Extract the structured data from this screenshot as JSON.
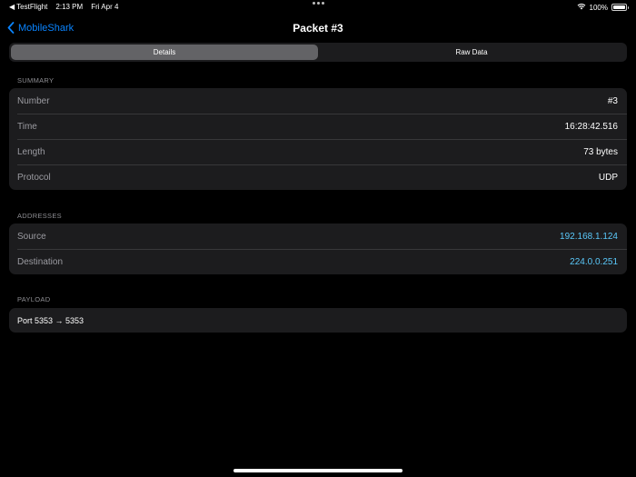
{
  "status": {
    "back_app": "TestFlight",
    "time": "2:13 PM",
    "date": "Fri Apr 4",
    "battery": "100%",
    "battery_level": 1.0
  },
  "nav": {
    "back_label": "MobileShark",
    "title": "Packet #3"
  },
  "tabs": [
    {
      "label": "Details",
      "selected": true
    },
    {
      "label": "Raw Data",
      "selected": false
    }
  ],
  "summary": {
    "header": "SUMMARY",
    "rows": [
      {
        "label": "Number",
        "value": "#3"
      },
      {
        "label": "Time",
        "value": "16:28:42.516"
      },
      {
        "label": "Length",
        "value": "73 bytes"
      },
      {
        "label": "Protocol",
        "value": "UDP"
      }
    ]
  },
  "addresses": {
    "header": "ADDRESSES",
    "rows": [
      {
        "label": "Source",
        "value": "192.168.1.124"
      },
      {
        "label": "Destination",
        "value": "224.0.0.251"
      }
    ]
  },
  "payload": {
    "header": "PAYLOAD",
    "text": "Port 5353 → 5353"
  },
  "colors": {
    "accent": "#0a84ff",
    "link": "#5ac8fa",
    "background": "#000000",
    "card": "#1c1c1e"
  }
}
